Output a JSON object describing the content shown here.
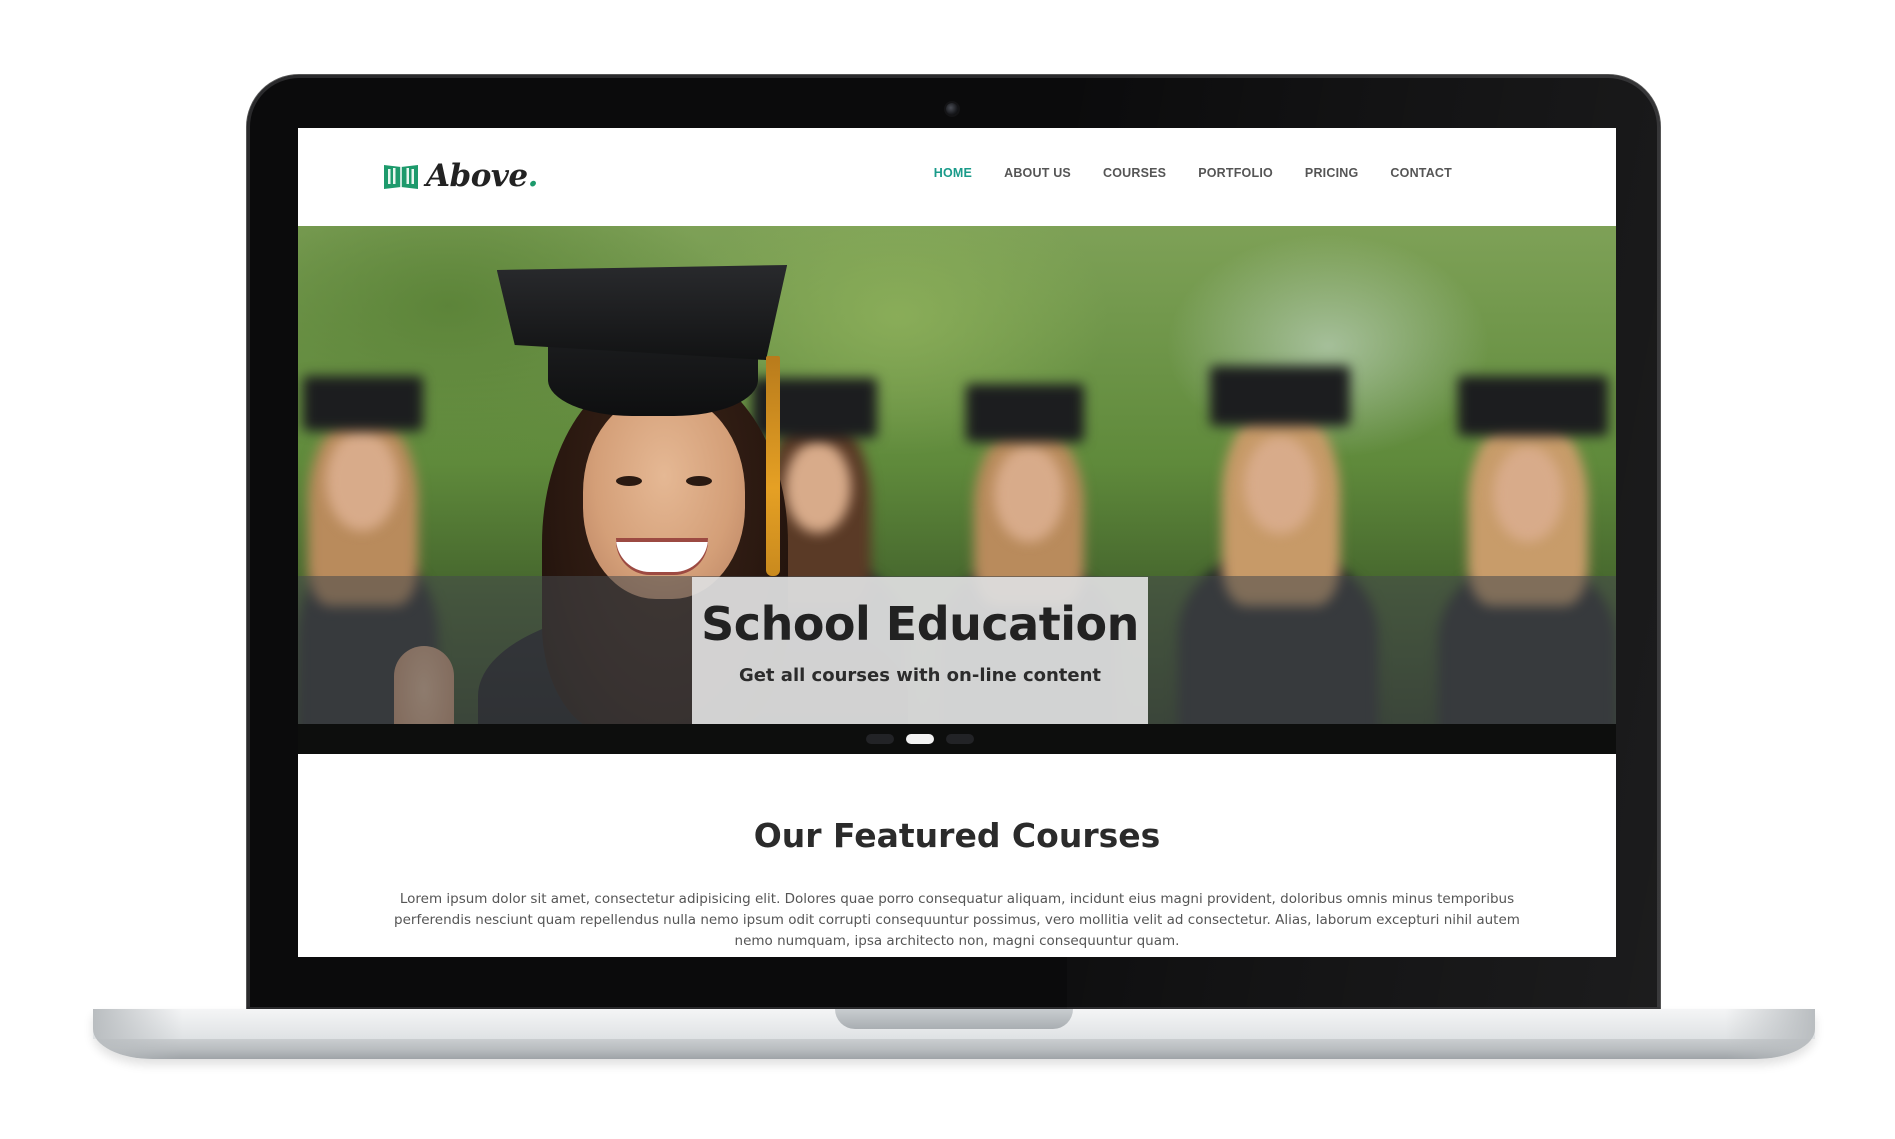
{
  "brand": {
    "name": "Above",
    "dot": ".",
    "accent_color": "#1a9b8a",
    "logo_icon": "book-icon"
  },
  "nav": {
    "items": [
      {
        "label": "HOME",
        "active": true
      },
      {
        "label": "ABOUT US",
        "active": false
      },
      {
        "label": "COURSES",
        "active": false
      },
      {
        "label": "PORTFOLIO",
        "active": false
      },
      {
        "label": "PRICING",
        "active": false
      },
      {
        "label": "CONTACT",
        "active": false
      }
    ]
  },
  "hero": {
    "title": "School Education",
    "subtitle": "Get all courses with on-line content",
    "slides": 3,
    "active_slide": 2
  },
  "featured": {
    "title": "Our Featured Courses",
    "text": "Lorem ipsum dolor sit amet, consectetur adipisicing elit. Dolores quae porro consequatur aliquam, incidunt eius magni provident, doloribus omnis minus temporibus perferendis nesciunt quam repellendus nulla nemo ipsum odit corrupti consequuntur possimus, vero mollitia velit ad consectetur. Alias, laborum excepturi nihil autem nemo numquam, ipsa architecto non, magni consequuntur quam."
  }
}
